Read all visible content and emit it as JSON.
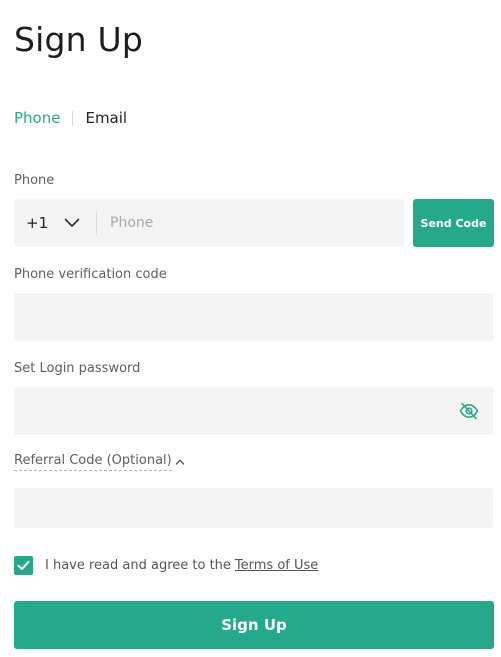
{
  "page": {
    "title": "Sign Up"
  },
  "tabs": [
    {
      "label": "Phone",
      "active": true
    },
    {
      "label": "Email",
      "active": false
    }
  ],
  "phone": {
    "label": "Phone",
    "country_code": "+1",
    "placeholder": "Phone",
    "value": "",
    "send_code_label": "Send Code"
  },
  "verification": {
    "label": "Phone verification code",
    "value": ""
  },
  "password": {
    "label": "Set Login password",
    "value": "",
    "toggle_icon": "eye-off-icon"
  },
  "referral": {
    "label": "Referral Code (Optional)",
    "expanded": true,
    "value": ""
  },
  "agreement": {
    "checked": true,
    "text": "I have read and agree to the",
    "link_text": "Terms of Use"
  },
  "submit": {
    "label": "Sign Up"
  },
  "colors": {
    "accent": "#26a98a",
    "input_bg": "#f4f4f4",
    "label": "#5f5f5f"
  }
}
